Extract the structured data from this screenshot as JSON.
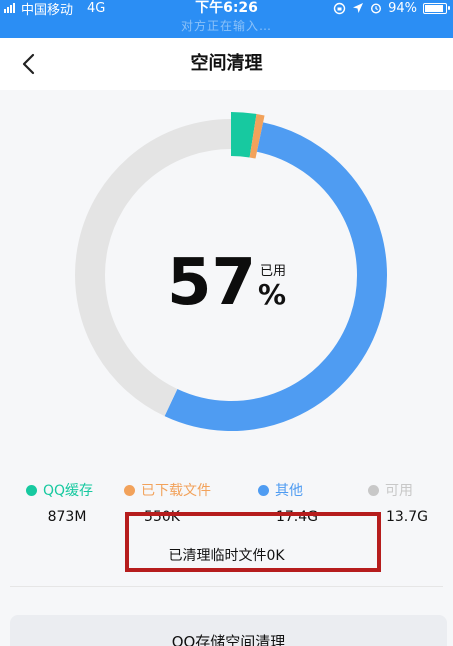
{
  "status_bar": {
    "carrier": "中国移动",
    "network": "4G",
    "time": "下午6:26",
    "battery": "94%",
    "battery_level": 0.94,
    "sub_status": "对方正在输入…"
  },
  "nav": {
    "back_icon": "chevron-left-icon",
    "title": "空间清理"
  },
  "usage": {
    "percent": "57",
    "used_label": "已用",
    "percent_sign": "%"
  },
  "chart_data": {
    "type": "donut",
    "segments": [
      {
        "name": "QQ缓存",
        "color": "#17c9a0",
        "fraction": 0.025
      },
      {
        "name": "已下载文件",
        "color": "#f2a25b",
        "fraction": 0.008
      },
      {
        "name": "其他",
        "color": "#4f9cf2",
        "fraction": 0.537
      },
      {
        "name": "可用",
        "color": "#e4e4e4",
        "fraction": 0.43
      }
    ]
  },
  "legend": [
    {
      "label": "QQ缓存",
      "value": "873M",
      "color": "#17c9a0"
    },
    {
      "label": "已下载文件",
      "value": "550K",
      "color": "#f2a25b"
    },
    {
      "label": "其他",
      "value": "17.4G",
      "color": "#4f9cf2"
    },
    {
      "label": "可用",
      "value": "13.7G",
      "color": "#c8c8c8"
    }
  ],
  "cleaned_text": "已清理临时文件0K",
  "card": {
    "label": "QQ存储空间清理"
  }
}
